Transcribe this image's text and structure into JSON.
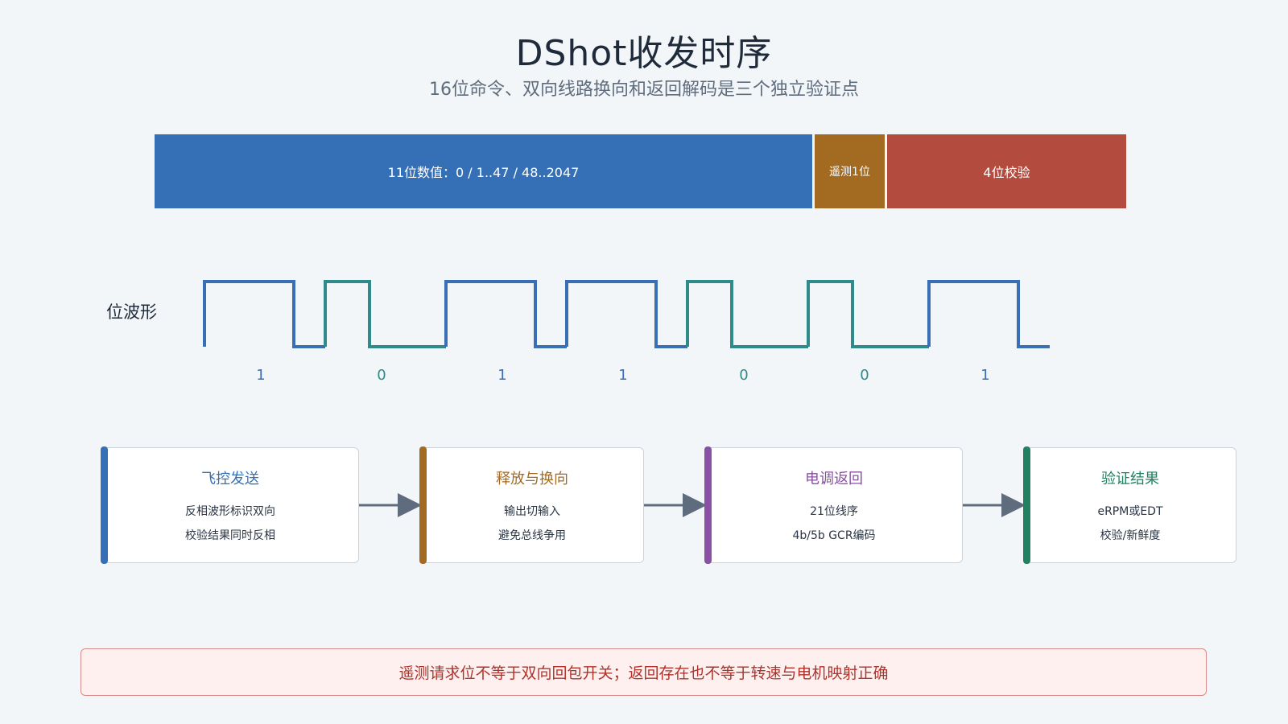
{
  "title": "DShot收发时序",
  "subtitle": "16位命令、双向线路换向和返回解码是三个独立验证点",
  "frame_fields": [
    {
      "label": "11位数值：0 / 1..47 / 48..2047",
      "color": "#3570b6"
    },
    {
      "label": "遥测1位",
      "color": "#a36b22"
    },
    {
      "label": "4位校验",
      "color": "#b34c3f"
    }
  ],
  "waveform": {
    "label": "位波形",
    "bits": [
      "1",
      "0",
      "1",
      "1",
      "0",
      "0",
      "1"
    ],
    "color_one": "#3a6fb6",
    "color_zero": "#2f8a8a"
  },
  "stages": [
    {
      "title": "飞控发送",
      "lines": [
        "反相波形标识双向",
        "校验结果同时反相"
      ],
      "color": "#3570b6"
    },
    {
      "title": "释放与换向",
      "lines": [
        "输出切输入",
        "避免总线争用"
      ],
      "color": "#a36b22"
    },
    {
      "title": "电调返回",
      "lines": [
        "21位线序",
        "4b/5b GCR编码"
      ],
      "color": "#8a50a3"
    },
    {
      "title": "验证结果",
      "lines": [
        "eRPM或EDT",
        "校验/新鲜度"
      ],
      "color": "#238060"
    }
  ],
  "arrow_color": "#5f6c7d",
  "note": "遥测请求位不等于双向回包开关；返回存在也不等于转速与电机映射正确"
}
